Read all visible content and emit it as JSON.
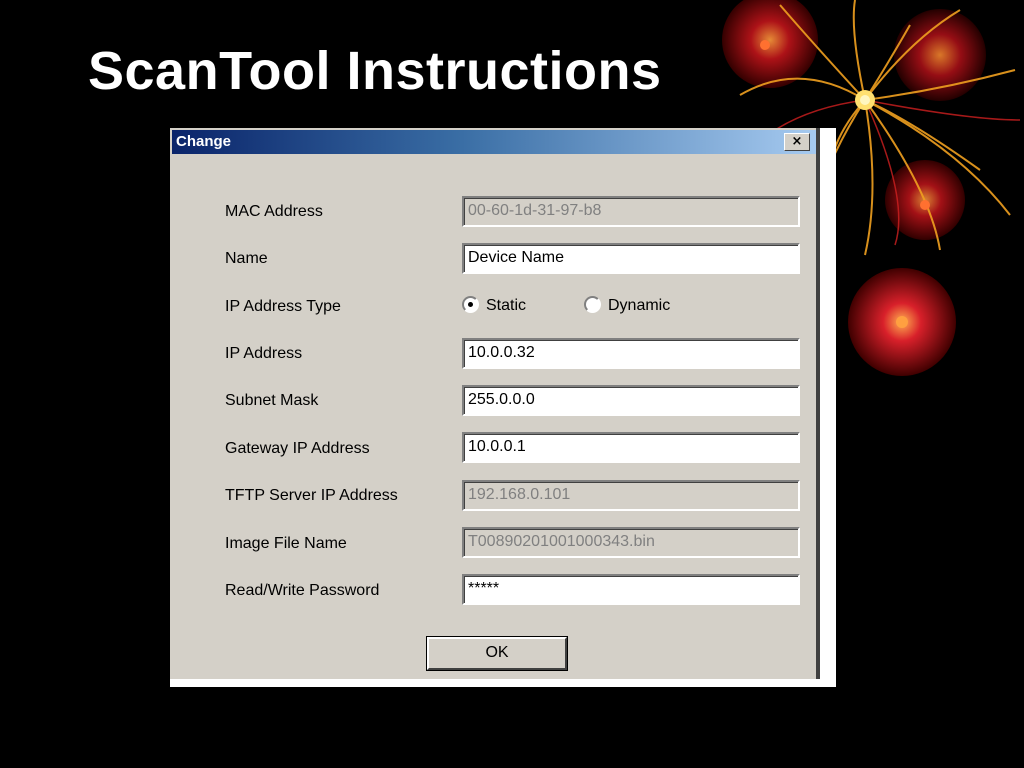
{
  "slide": {
    "title": "ScanTool Instructions"
  },
  "dialog": {
    "title": "Change",
    "close_label": "×",
    "fields": [
      {
        "label": "MAC Address",
        "value": "00-60-1d-31-97-b8",
        "enabled": false
      },
      {
        "label": "Name",
        "value": "Device Name",
        "enabled": true
      },
      {
        "label": "IP Address Type",
        "value": null,
        "enabled": true
      },
      {
        "label": "IP Address",
        "value": "10.0.0.32",
        "enabled": true
      },
      {
        "label": "Subnet Mask",
        "value": "255.0.0.0",
        "enabled": true
      },
      {
        "label": "Gateway IP Address",
        "value": "10.0.0.1",
        "enabled": true
      },
      {
        "label": "TFTP Server IP Address",
        "value": "192.168.0.101",
        "enabled": false
      },
      {
        "label": "Image File Name",
        "value": "T00890201001000343.bin",
        "enabled": false
      },
      {
        "label": "Read/Write Password",
        "value": "*****",
        "enabled": true
      }
    ],
    "ip_type_options": [
      {
        "label": "Static",
        "checked": true
      },
      {
        "label": "Dynamic",
        "checked": false
      }
    ],
    "ok_label": "OK"
  },
  "colors": {
    "background": "#000000",
    "dialog_face": "#d4d0c8",
    "titlebar_start": "#0a246a",
    "titlebar_end": "#a6caf0",
    "title_text": "#ffffff"
  }
}
